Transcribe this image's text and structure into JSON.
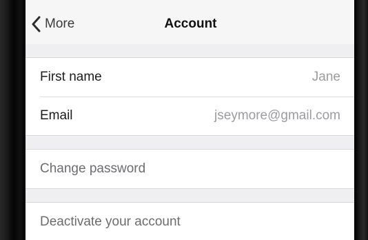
{
  "navbar": {
    "back_label": "More",
    "title": "Account"
  },
  "profile": {
    "rows": [
      {
        "label": "First name",
        "value": "Jane"
      },
      {
        "label": "Email",
        "value": "jseymore@gmail.com"
      }
    ]
  },
  "security": {
    "change_password_label": "Change password"
  },
  "danger": {
    "deactivate_label": "Deactivate your account"
  },
  "colors": {
    "background": "#efeff1",
    "cell": "#ffffff",
    "value_text": "#9b9ba0"
  },
  "icons": {
    "back": "chevron-left-icon"
  }
}
